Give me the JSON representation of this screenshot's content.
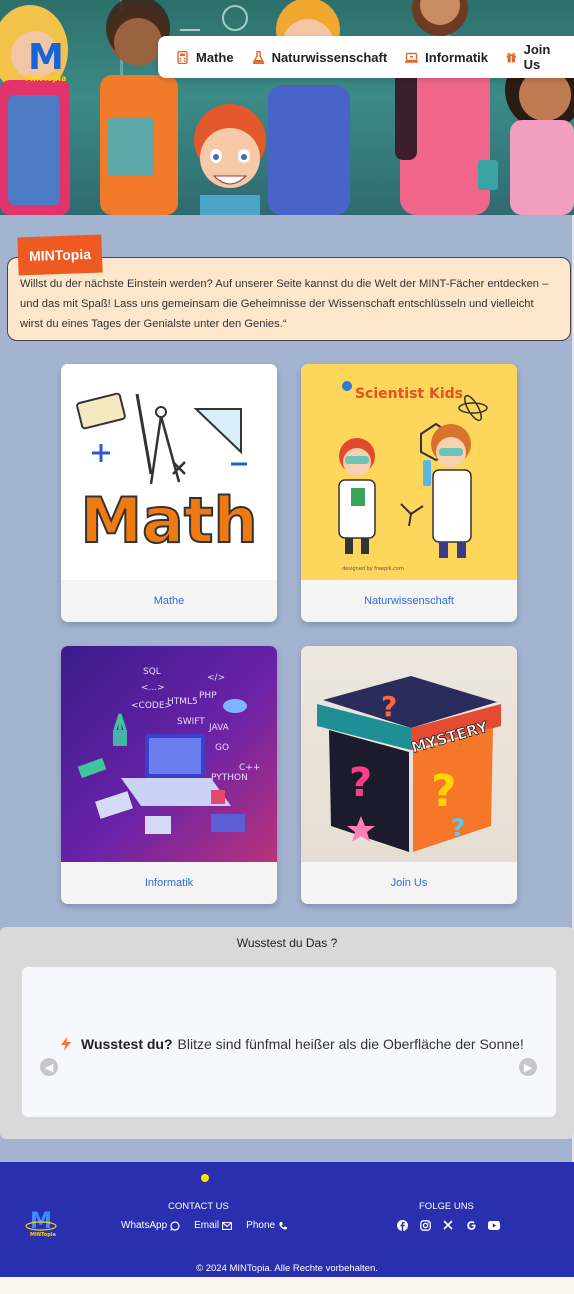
{
  "brand": {
    "logo_letter": "M",
    "logo_text": "MINTopia"
  },
  "nav": {
    "items": [
      {
        "label": "Mathe",
        "icon": "calculator-icon"
      },
      {
        "label": "Naturwissenschaft",
        "icon": "flask-icon"
      },
      {
        "label": "Informatik",
        "icon": "laptop-icon"
      },
      {
        "label": "Join Us",
        "icon": "gift-icon"
      }
    ]
  },
  "intro": {
    "badge": "MINTopia",
    "text": "Willst du der nächste Einstein werden? Auf unserer Seite kannst du die Welt der MINT-Fächer entdecken – und das mit Spaß! Lass uns gemeinsam die Geheimnisse der Wissenschaft entschlüsseln und vielleicht wirst du eines Tages der Genialste unter den Genies.“"
  },
  "cards": [
    {
      "caption": "Mathe",
      "image_text": "Math"
    },
    {
      "caption": "Naturwissenschaft",
      "image_text": "Scientist Kids",
      "credit": "designed by freepik.com"
    },
    {
      "caption": "Informatik",
      "image_words": [
        "SQL",
        "HTML5",
        "PHP",
        "<CODE>",
        "SWIFT",
        "JAVA",
        "GO",
        "C++",
        "PYTHON",
        "<...>",
        "</>"
      ]
    },
    {
      "caption": "Join Us",
      "image_text": "MYSTERY"
    }
  ],
  "facts": {
    "title": "Wusstest du Das ?",
    "fact_bold": "Wusstest du?",
    "fact_text": "Blitze sind fünfmal heißer als die Oberfläche der Sonne!",
    "prev_icon": "chevron-left-icon",
    "next_icon": "chevron-right-icon"
  },
  "footer": {
    "contact_title": "CONTACT US",
    "links": [
      {
        "label": "WhatsApp",
        "icon": "whatsapp-icon"
      },
      {
        "label": "Email",
        "icon": "envelope-icon"
      },
      {
        "label": "Phone",
        "icon": "phone-icon"
      }
    ],
    "follow_title": "FOLGE UNS",
    "social": [
      "facebook-icon",
      "instagram-icon",
      "x-icon",
      "google-icon",
      "youtube-icon"
    ],
    "copyright": "© 2024 MINTopia. Alle Rechte vorbehalten.",
    "logo_text": "MINTopia"
  },
  "colors": {
    "page_bg": "#a3b4d1",
    "nav_bg": "#ffffff",
    "nav_icon": "#e0672a",
    "intro_bg": "#fde7cc",
    "badge_bg": "#ef5a23",
    "card_caption": "#2f6ddb",
    "footer_bg": "#2a2faf",
    "facts_bg": "#d9d9d9"
  }
}
